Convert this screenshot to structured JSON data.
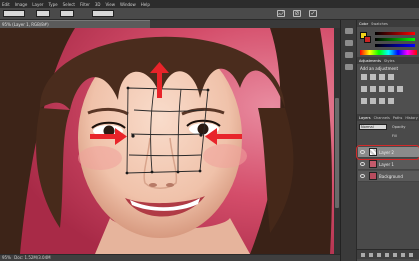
{
  "menubar": {
    "items": [
      "Edit",
      "Image",
      "Layer",
      "Type",
      "Select",
      "Filter",
      "3D",
      "View",
      "Window",
      "Help"
    ]
  },
  "options_bar": {
    "confirm_icon": "check-icon",
    "cancel_icon": "cancel-icon",
    "undo_icon": "rotate-icon"
  },
  "document": {
    "tab_title": "95% (Layer 1, RGB/8#)",
    "zoom": "95%",
    "status": "Doc: 1.52M/3.04M"
  },
  "panels": {
    "color_tabs": [
      "Color",
      "Swatches"
    ],
    "adjustments_tabs": [
      "Adjustments",
      "Styles"
    ],
    "adjustments_title": "Add an adjustment",
    "layers_tabs": [
      "Layers",
      "Channels",
      "Paths",
      "History"
    ],
    "blend_mode": "Normal",
    "opacity_label": "Opacity",
    "fill_label": "Fill",
    "layers": [
      {
        "name": "Layer 2",
        "selected": true
      },
      {
        "name": "Layer 1",
        "selected": false
      },
      {
        "name": "Background",
        "selected": false
      }
    ]
  },
  "colors": {
    "foreground": "#f2d21a",
    "background": "#cc2222",
    "highlight_ring": "#d22a2a",
    "arrow": "#e8242a"
  }
}
